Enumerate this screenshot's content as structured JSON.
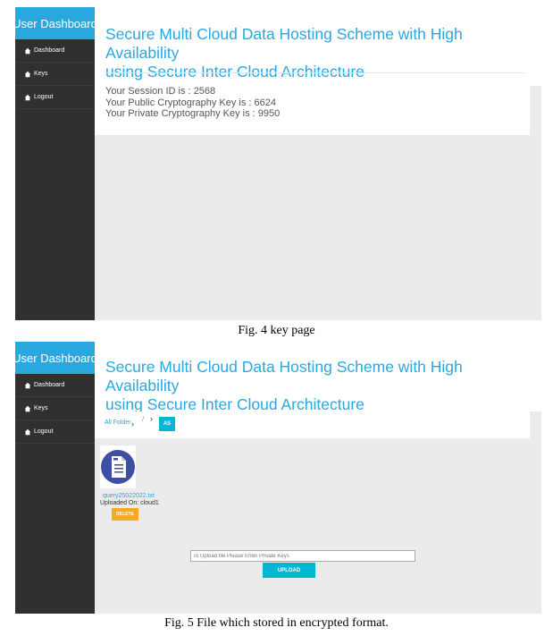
{
  "sidebar": {
    "title": "User Dashboard",
    "items": [
      {
        "label": "Dashboard",
        "icon": "dashboard-icon"
      },
      {
        "label": "Keys",
        "icon": "keys-icon"
      },
      {
        "label": "Logout",
        "icon": "logout-icon"
      }
    ]
  },
  "header": {
    "title_line1": "Secure Multi Cloud Data Hosting Scheme with High Availability",
    "title_line2": "using Secure Inter Cloud Architecture"
  },
  "key_page": {
    "session": "Your Session ID is : 2568",
    "public_key": "Your Public Cryptography Key is : 6624",
    "private_key": "Your Private Cryptography Key is : 9950"
  },
  "file_page": {
    "breadcrumb_root": "All Folder",
    "breadcrumb_sep": "/",
    "badge": "AS",
    "file": {
      "name": "query25022022.txt",
      "location": "Uploaded On: cloud1",
      "icon": "document-icon",
      "delete_label": "DELETE"
    },
    "upload_placeholder": "To Upload file Please Enter Private Keys",
    "upload_label": "UPLOAD"
  },
  "captions": {
    "fig4": "Fig. 4 key page",
    "fig5": "Fig. 5 File which stored in encrypted format."
  },
  "colors": {
    "accent": "#29a8e0",
    "sidebar": "#303030",
    "button_cyan": "#00b7d4",
    "button_orange": "#f9a825"
  }
}
